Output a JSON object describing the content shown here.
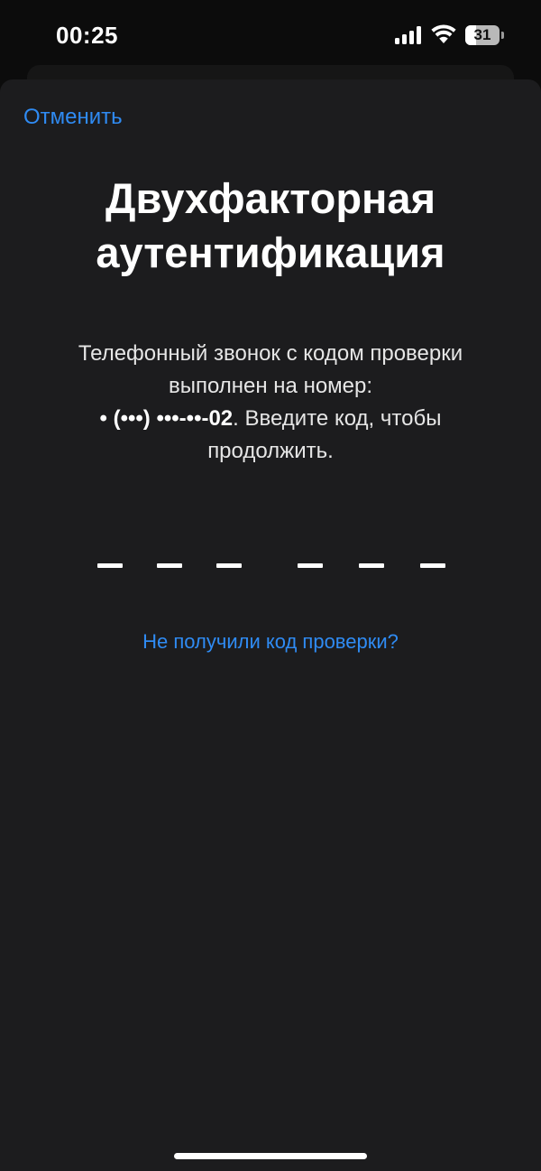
{
  "status_bar": {
    "time": "00:25",
    "battery_level": "31",
    "battery_fraction": 0.31
  },
  "header": {
    "cancel_label": "Отменить"
  },
  "title": {
    "line1": "Двухфакторная",
    "line2": "аутентификация"
  },
  "description": {
    "line1": "Телефонный звонок с кодом проверки",
    "line2": "выполнен на номер:",
    "phone": "• (•••) •••-••-02",
    "line3_suffix": ". Введите код, чтобы",
    "line4": "продолжить."
  },
  "code_input": {
    "digit_count": 6
  },
  "resend": {
    "label": "Не получили код проверки?"
  },
  "colors": {
    "accent": "#2f8bf3",
    "sheet_background": "#1c1c1e",
    "text": "#ffffff"
  },
  "icons": [
    "signal-icon",
    "wifi-icon",
    "battery-icon"
  ]
}
